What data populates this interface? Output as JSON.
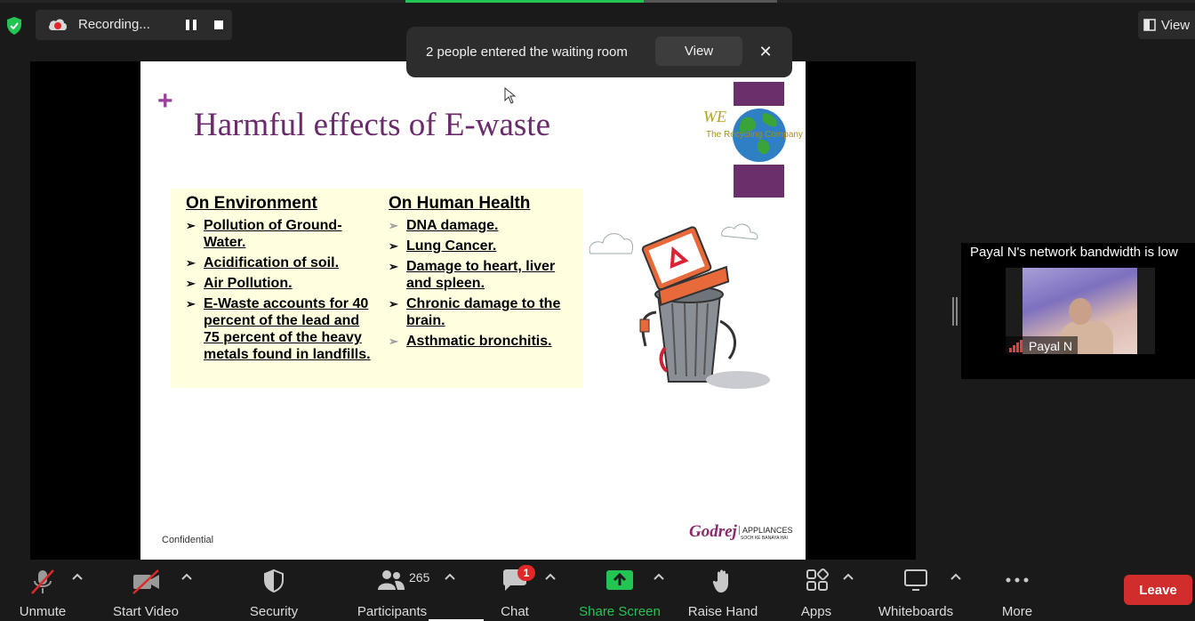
{
  "recording": {
    "label": "Recording..."
  },
  "view_menu": {
    "label": "View"
  },
  "notification": {
    "text": "2 people entered the waiting room",
    "view_label": "View",
    "close_symbol": "✕"
  },
  "slide": {
    "title": "Harmful effects of E-waste",
    "plus_symbol": "+",
    "logo": {
      "we": "WE",
      "company": "The Recycling Company"
    },
    "environment": {
      "heading": "On Environment",
      "items": [
        "Pollution of Ground-Water.",
        "Acidification of soil.",
        "Air Pollution.",
        "E-Waste accounts for 40 percent of the lead and 75 percent of the heavy metals found in landfills."
      ]
    },
    "health": {
      "heading": "On Human Health",
      "items": [
        "DNA damage.",
        "Lung Cancer.",
        "Damage to heart, liver and spleen.",
        "Chronic damage to the brain.",
        "Asthmatic bronchitis."
      ]
    },
    "footer_left": "Confidential",
    "brand": {
      "name": "Godrej",
      "tagline": "APPLIANCES",
      "sub": "SOCH KE BANAYA HAI"
    }
  },
  "participant_video": {
    "warning": "Payal N's network bandwidth is low",
    "name": "Payal N"
  },
  "toolbar": {
    "unmute": "Unmute",
    "start_video": "Start Video",
    "security": "Security",
    "participants": "Participants",
    "participants_count": "265",
    "chat": "Chat",
    "chat_badge": "1",
    "share_screen": "Share Screen",
    "raise_hand": "Raise Hand",
    "apps": "Apps",
    "whiteboards": "Whiteboards",
    "more": "More",
    "leave": "Leave"
  },
  "colors": {
    "accent_green": "#23c552",
    "leave_red": "#d22d2d",
    "slide_title": "#6b2a6b"
  }
}
